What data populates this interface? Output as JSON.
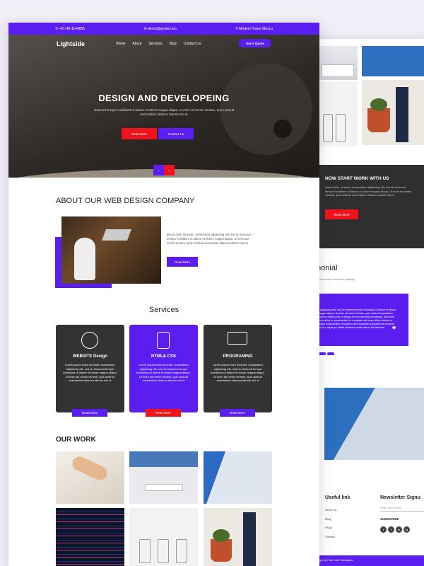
{
  "topbar": {
    "phone": "+01-40-1144855",
    "email": "demo@gmail.com",
    "address": "Modern Tower Moscu"
  },
  "nav": {
    "logo": "Lightside",
    "items": [
      "Home",
      "About",
      "Services",
      "Blog",
      "Contact Us"
    ],
    "quote_btn": "Get A Quote"
  },
  "hero": {
    "title": "DESIGN AND DEVELOPEING",
    "text": "eiusmod tempor incididunt ut labore et dolore magna aliqua. Ut enim ad minim veniam, quis nostrud exercitation ullamco laboris nisi ut",
    "btn_read": "Read More",
    "btn_contact": "Contact Us"
  },
  "about": {
    "title": "ABOUT OUR WEB DESIGN COMPANY",
    "text": "ipsum dolor sit amet, consectetur adipiscing elit, sed do eiusmod tempor incididunt ut labore et dolore magna aliqua. Ut enim ad minim veniam, quis nostrud exercitation ullamco laboris nisi ut",
    "btn": "Read More"
  },
  "services": {
    "title": "Services",
    "cards": [
      {
        "title": "WEBSITE Design",
        "text": "Lorem ipsum dolor sit amet, consectetur adipiscing elit, sed do eiusmod tempor incididunt ut labore et dolore magna aliqua. Ut enim ad minim veniam, quis nostrud exercitation ullamco laboris nisi ut",
        "btn": "Read More"
      },
      {
        "title": "HTML& CSS",
        "text": "Lorem ipsum dolor sit amet, consectetur adipiscing elit, sed do eiusmod tempor incididunt ut labore et dolore magna aliqua. Ut enim ad minim veniam, quis nostrud exercitation ullamco laboris nisi ut",
        "btn": "Read More"
      },
      {
        "title": "PROGRAMING",
        "text": "Lorem ipsum dolor sit amet, consectetur adipiscing elit, sed do eiusmod tempor incididunt ut labore et dolore magna aliqua. Ut enim ad minim veniam, quis nostrud exercitation ullamco laboris nisi ut",
        "btn": "Read More"
      }
    ]
  },
  "work": {
    "title": "OUR WORK"
  },
  "back": {
    "start_title": "NOW START WORK WITH US",
    "start_text": "ipsum dolor sit amet, consectetur adipiscing elit, sed do eiusmod tempor incididunt ut labore et dolore magna aliqua. Ut enim ad minim veniam, quis nostrud exercitation ullamco laboris nisi ut",
    "start_btn": "Read More",
    "testimonial_title": "monial",
    "testimonial_sub": "ds which don't look even slightly",
    "testimonial_text": "r adipiscing elit, sed do eiusmod tempor incididunt ut labore et dolore magna aliqua. Ut enim ad minim veniam, quis nostrud exercitation ullamco laboris nisi ut aliquip ex ea commodo consequat. Duis aute irure dolor in reprehenderit in voluptate velit esse cillum dolore eu fugiat nulla pariatur. Excepteur sint occaecat cupidatat non proident, sunt in culpa qui officia deserunt mollit anim id est laborum.",
    "useful_title": "Useful link",
    "useful_links": [
      "About Us",
      "Blog",
      "FAQs",
      "Contact"
    ],
    "newsletter_title": "Newsletter Signu",
    "email_placeholder": "Enter Your Email",
    "subscribe": "SUBSCRIBE",
    "social": [
      "f",
      "t",
      "in",
      "ig"
    ],
    "footer": "esign by Free html Templates"
  },
  "colors": {
    "accent": "#5a1ff0",
    "red": "#f0131c",
    "dark": "#333333"
  }
}
